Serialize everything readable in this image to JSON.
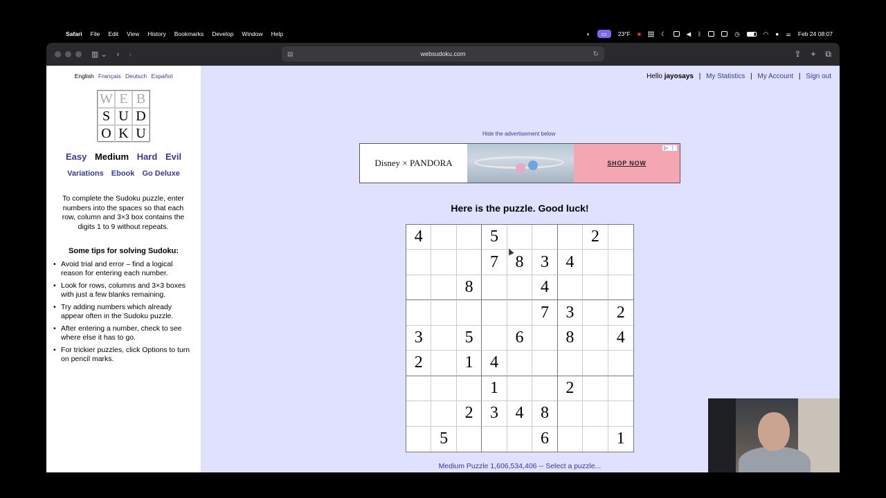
{
  "menubar": {
    "app": "Safari",
    "items": [
      "File",
      "Edit",
      "View",
      "History",
      "Bookmarks",
      "Develop",
      "Window",
      "Help"
    ],
    "weather": "23°F",
    "datetime": "Feb 24  08:07"
  },
  "browser": {
    "url": "websudoku.com"
  },
  "sidebar": {
    "languages": [
      "English",
      "Français",
      "Deutsch",
      "Español"
    ],
    "logo": [
      "W",
      "E",
      "B",
      "S",
      "U",
      "D",
      "O",
      "K",
      "U"
    ],
    "levels": [
      "Easy",
      "Medium",
      "Hard",
      "Evil"
    ],
    "sublinks": [
      "Variations",
      "Ebook",
      "Go Deluxe"
    ],
    "intro": "To complete the Sudoku puzzle, enter numbers into the spaces so that each row, column and 3×3 box contains the digits 1 to 9 without repeats.",
    "tips_title": "Some tips for solving Sudoku:",
    "tips": [
      "Avoid trial and error – find a logical reason for entering each number.",
      "Look for rows, columns and 3×3 boxes with just a few blanks remaining.",
      "Try adding numbers which already appear often in the Sudoku puzzle.",
      "After entering a number, check to see where else it has to go.",
      "For trickier puzzles, click Options to turn on pencil marks."
    ]
  },
  "account": {
    "hello": "Hello",
    "username": "jayosays",
    "stats": "My Statistics",
    "my_account": "My Account",
    "sign_out": "Sign out"
  },
  "ad": {
    "hide_label": "Hide the advertisement below",
    "brand": "Disney × PANDORA",
    "cta": "SHOP NOW"
  },
  "puzzle": {
    "title": "Here is the puzzle. Good luck!",
    "grid": [
      [
        "4",
        "",
        "",
        "5",
        "",
        "",
        "",
        "2",
        ""
      ],
      [
        "",
        "",
        "",
        "7",
        "8",
        "3",
        "4",
        "",
        ""
      ],
      [
        "",
        "",
        "8",
        "",
        "",
        "4",
        "",
        "",
        ""
      ],
      [
        "",
        "",
        "",
        "",
        "",
        "7",
        "3",
        "",
        "2"
      ],
      [
        "3",
        "",
        "5",
        "",
        "6",
        "",
        "8",
        "",
        "4"
      ],
      [
        "2",
        "",
        "1",
        "4",
        "",
        "",
        "",
        "",
        ""
      ],
      [
        "",
        "",
        "",
        "1",
        "",
        "",
        "2",
        "",
        ""
      ],
      [
        "",
        "",
        "2",
        "3",
        "4",
        "8",
        "",
        "",
        ""
      ],
      [
        "",
        "5",
        "",
        "",
        "",
        "6",
        "",
        "",
        "1"
      ]
    ],
    "footer": "Medium Puzzle 1,606,534,406 -- Select a puzzle..."
  }
}
